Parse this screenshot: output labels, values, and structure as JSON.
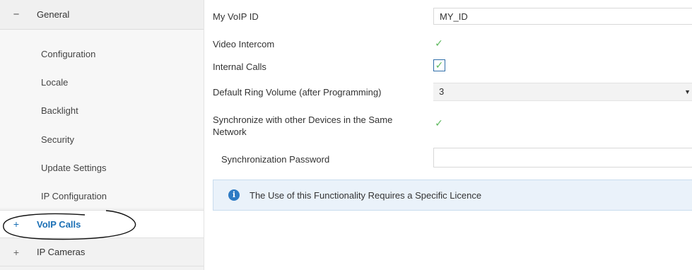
{
  "sidebar": {
    "general": {
      "toggle": "−",
      "label": "General"
    },
    "items": [
      {
        "label": "Configuration"
      },
      {
        "label": "Locale"
      },
      {
        "label": "Backlight"
      },
      {
        "label": "Security"
      },
      {
        "label": "Update Settings"
      },
      {
        "label": "IP Configuration"
      }
    ],
    "voip": {
      "toggle": "+",
      "label": "VoIP Calls"
    },
    "cameras": {
      "toggle": "+",
      "label": "IP Cameras"
    }
  },
  "form": {
    "voip_id": {
      "label": "My VoIP ID",
      "value": "MY_ID"
    },
    "video_intercom": {
      "label": "Video Intercom",
      "checked": true
    },
    "internal_calls": {
      "label": "Internal Calls",
      "checked": true
    },
    "ring_volume": {
      "label": "Default Ring Volume (after Programming)",
      "value": "3"
    },
    "sync_devices": {
      "label_line1": "Synchronize with other Devices in the Same",
      "label_line2": "Network",
      "checked": true
    },
    "sync_password": {
      "label": "Synchronization Password",
      "value": ""
    },
    "info": {
      "text": "The Use of this Functionality Requires a Specific Licence"
    }
  },
  "glyphs": {
    "check": "✓",
    "caret": "▼",
    "info": "i"
  },
  "colors": {
    "accent": "#1a6fb5",
    "check": "#5cb85c",
    "info_bg": "#eaf2fa"
  }
}
